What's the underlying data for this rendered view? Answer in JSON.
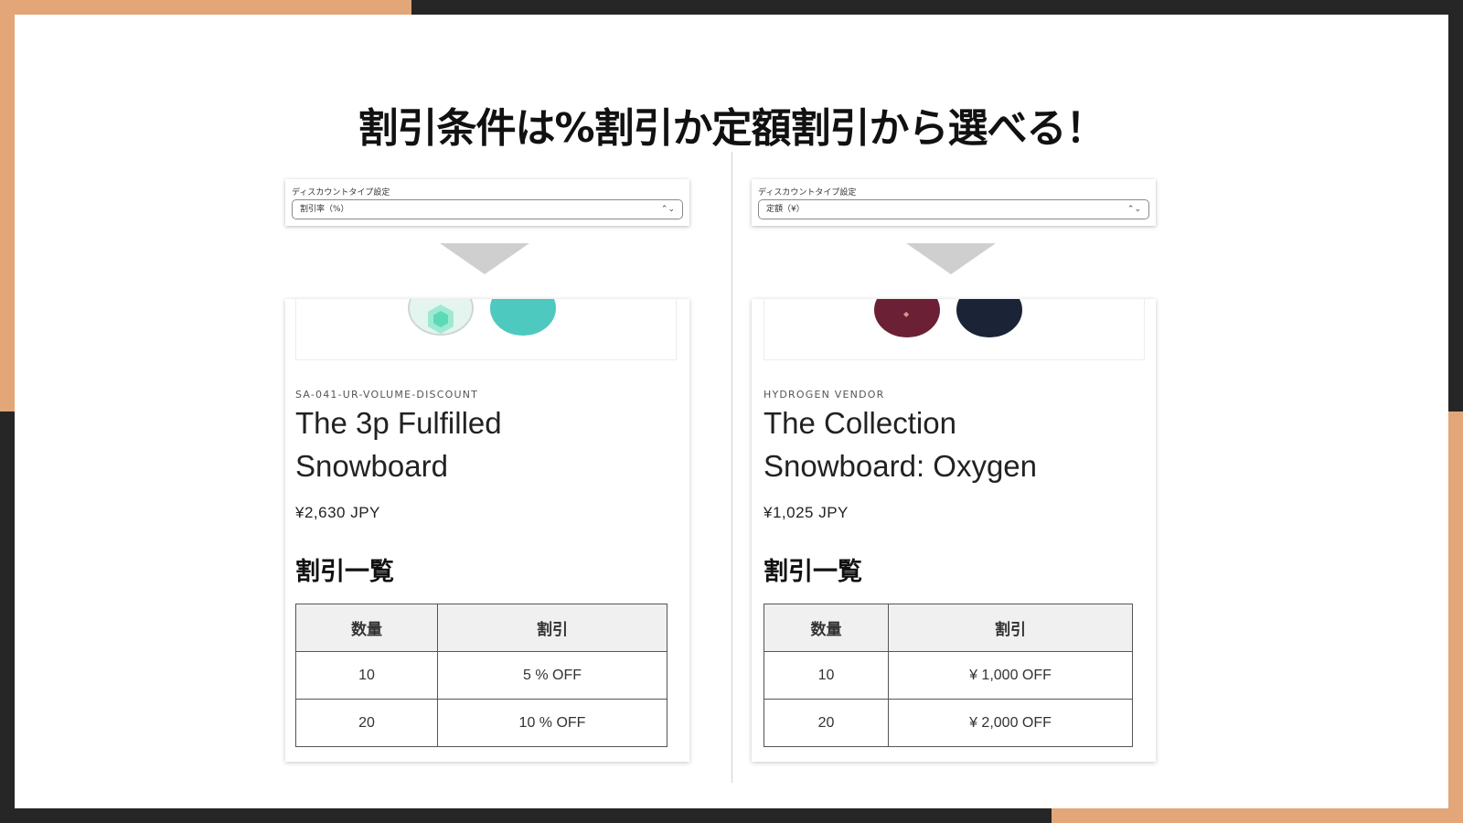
{
  "slide": {
    "title": "割引条件は%割引か定額割引から選べる！"
  },
  "panels": [
    {
      "setting_label": "ディスカウントタイプ設定",
      "select_value": "割引率（%）",
      "product": {
        "vendor": "SA-041-UR-VOLUME-DISCOUNT",
        "title": "The 3p Fulfilled Snowboard",
        "price": "¥2,630 JPY",
        "image_colors": [
          "#e4f4ee",
          "#4dc9c0"
        ]
      },
      "discount_list_title": "割引一覧",
      "table": {
        "headers": [
          "数量",
          "割引"
        ],
        "rows": [
          [
            "10",
            "5 % OFF"
          ],
          [
            "20",
            "10 % OFF"
          ]
        ]
      }
    },
    {
      "setting_label": "ディスカウントタイプ設定",
      "select_value": "定額（¥）",
      "product": {
        "vendor": "HYDROGEN VENDOR",
        "title": "The Collection Snowboard: Oxygen",
        "price": "¥1,025 JPY",
        "image_colors": [
          "#6b2035",
          "#1a2436"
        ]
      },
      "discount_list_title": "割引一覧",
      "table": {
        "headers": [
          "数量",
          "割引"
        ],
        "rows": [
          [
            "10",
            "¥ 1,000 OFF"
          ],
          [
            "20",
            "¥ 2,000 OFF"
          ]
        ]
      }
    }
  ],
  "colors": {
    "accent": "#e2a679",
    "frame": "#262626",
    "arrow": "#cfcfcf"
  }
}
